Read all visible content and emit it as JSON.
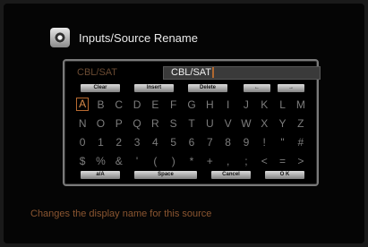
{
  "header": {
    "title": "Inputs/Source Rename",
    "icon": "speaker-icon"
  },
  "name_row": {
    "label": "CBL/SAT",
    "value": "CBL/SAT"
  },
  "top_buttons": {
    "clear": "Clear",
    "insert": "Insert",
    "delete": "Delete",
    "left": "←",
    "right": "→"
  },
  "keyboard_rows": [
    [
      "A",
      "B",
      "C",
      "D",
      "E",
      "F",
      "G",
      "H",
      "I",
      "J",
      "K",
      "L",
      "M"
    ],
    [
      "N",
      "O",
      "P",
      "Q",
      "R",
      "S",
      "T",
      "U",
      "V",
      "W",
      "X",
      "Y",
      "Z"
    ],
    [
      "0",
      "1",
      "2",
      "3",
      "4",
      "5",
      "6",
      "7",
      "8",
      "9",
      "!",
      "\"",
      "#"
    ],
    [
      "$",
      "%",
      "&",
      "'",
      "(",
      ")",
      "*",
      "+",
      ",",
      ";",
      "<",
      "=",
      ">"
    ]
  ],
  "selected_key": "A",
  "bottom_buttons": {
    "case": "a/A",
    "space": "Space",
    "cancel": "Cancel",
    "ok": "O K"
  },
  "help_text": "Changes the display name for this source",
  "colors": {
    "accent": "#d88a4a",
    "background": "#050505",
    "key_text": "#7d7d7d"
  }
}
